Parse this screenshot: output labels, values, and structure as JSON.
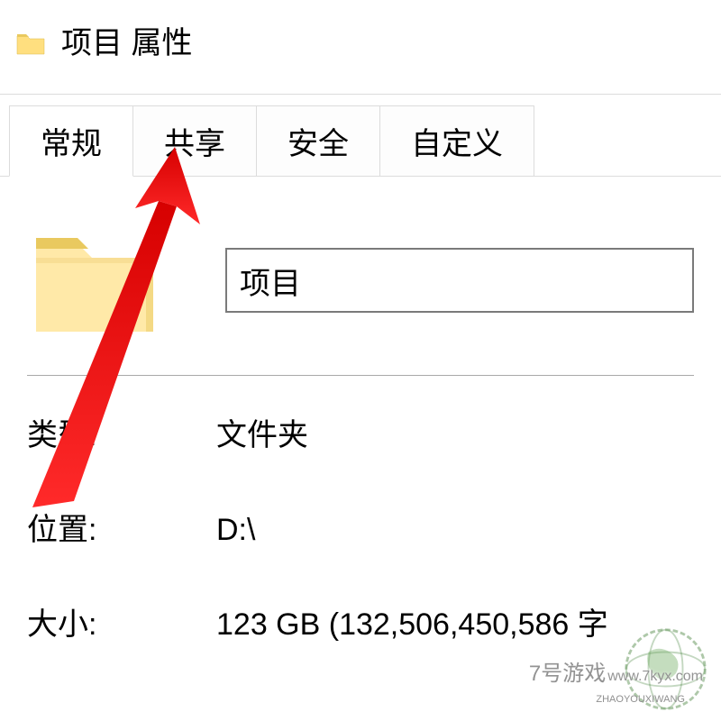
{
  "window": {
    "title": "项目 属性"
  },
  "tabs": [
    {
      "label": "常规",
      "active": true
    },
    {
      "label": "共享",
      "active": false
    },
    {
      "label": "安全",
      "active": false
    },
    {
      "label": "自定义",
      "active": false
    }
  ],
  "folder_name": "项目",
  "rows": {
    "type_label": "类型:",
    "type_value": "文件夹",
    "location_label": "位置:",
    "location_value": "D:\\",
    "size_label": "大小:",
    "size_value": "123 GB (132,506,450,586 字"
  },
  "watermark": {
    "brand": "7号游戏",
    "domain": "www.7kyx.com",
    "sub": "ZHAOYOUXIWANG"
  },
  "colors": {
    "arrow": "#ff0000",
    "folder_light": "#ffe9a8",
    "folder_dark": "#e9c95f"
  }
}
